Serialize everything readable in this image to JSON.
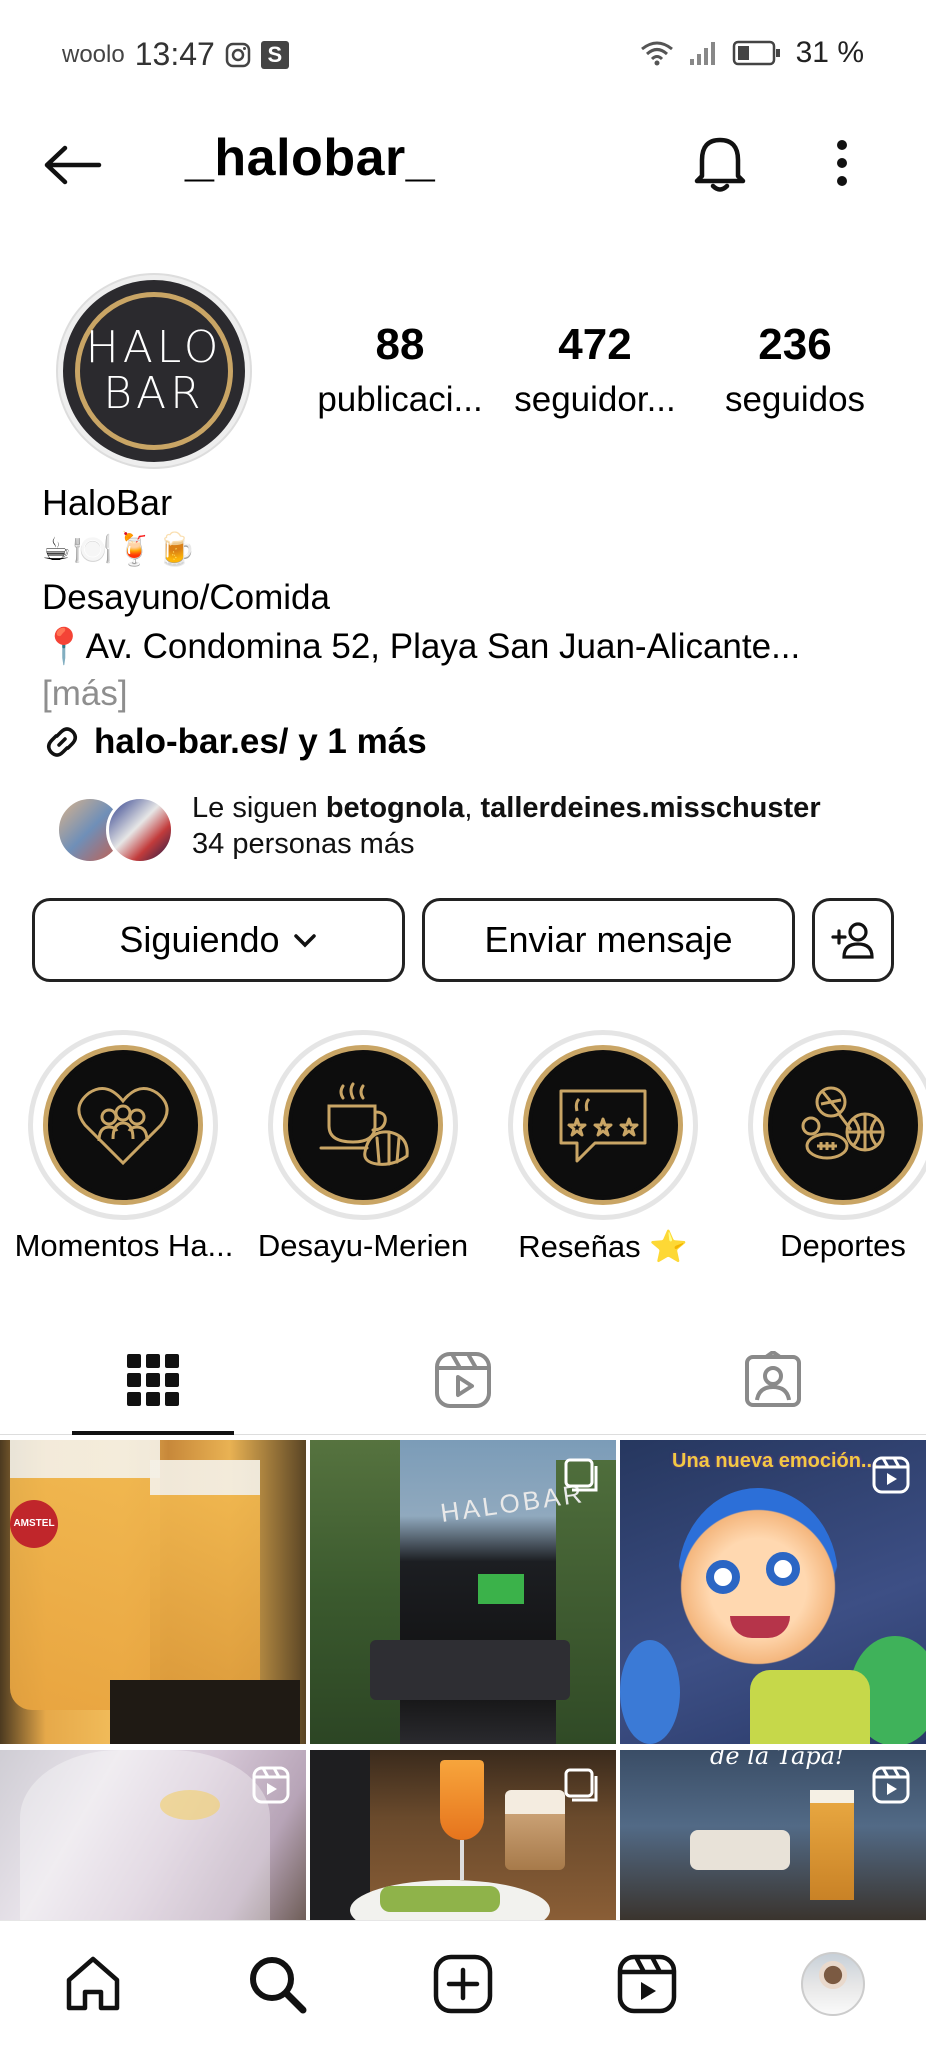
{
  "status_bar": {
    "carrier": "woolo",
    "time": "13:47",
    "s_badge": "S",
    "battery": "31 %"
  },
  "header": {
    "username": "_halobar_"
  },
  "avatar": {
    "line1": "HALO",
    "line2": "BAR"
  },
  "stats": [
    {
      "value": "88",
      "label": "publicaci..."
    },
    {
      "value": "472",
      "label": "seguidor..."
    },
    {
      "value": "236",
      "label": "seguidos"
    }
  ],
  "bio": {
    "name": "HaloBar",
    "emojis": "☕🍽️🍹🍺",
    "line1": "Desayuno/Comida",
    "line2": "📍Av. Condomina 52, Playa San Juan-Alicante...",
    "more": "[más]",
    "link": "halo-bar.es/ y 1 más"
  },
  "followed_by": {
    "prefix": "Le siguen ",
    "user1": "betognola",
    "sep": ", ",
    "user2": "tallerdeines.misschuster",
    "line2": "34 personas más"
  },
  "buttons": {
    "following": "Siguiendo",
    "message": "Enviar mensaje"
  },
  "highlights": [
    {
      "label": "Momentos Ha...",
      "icon": "heart-people-icon"
    },
    {
      "label": "Desayu-Merien",
      "icon": "coffee-croissant-icon"
    },
    {
      "label": "Reseñas ⭐",
      "icon": "review-stars-icon"
    },
    {
      "label": "Deportes",
      "icon": "sports-balls-icon"
    }
  ],
  "tabs": [
    "grid-icon",
    "reels-icon",
    "tagged-icon"
  ],
  "grid": {
    "post2_sign": "HALOBAR",
    "post3_caption": "Una nueva emoción...",
    "post4_brand": "AMSTEL",
    "post6_caption": "de la Tapa!"
  },
  "colors": {
    "accent_gold": "#c9a565",
    "text": "#000000",
    "muted": "#8e8e8e"
  }
}
